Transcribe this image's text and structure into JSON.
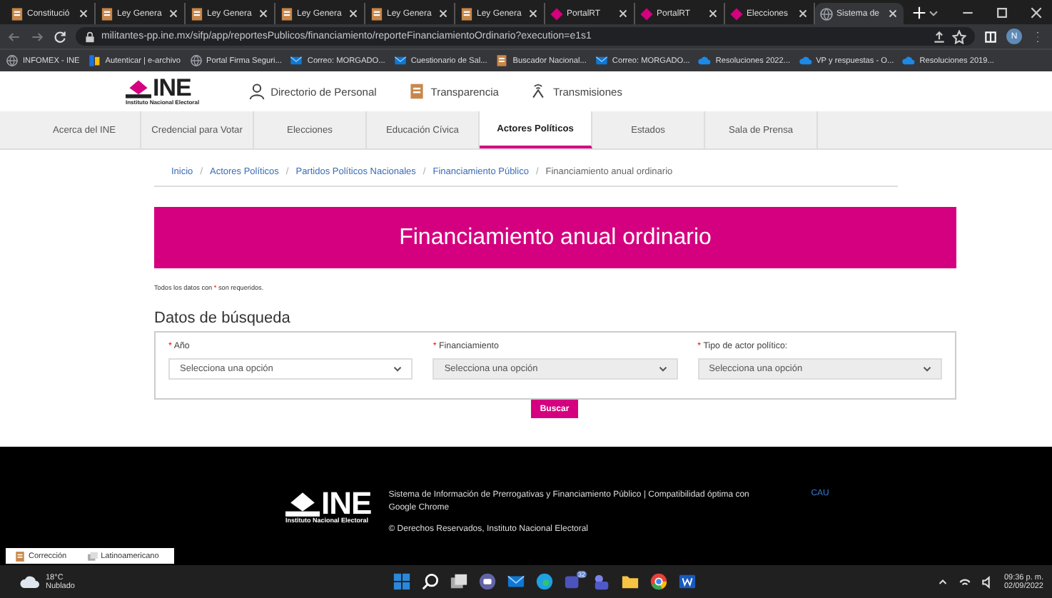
{
  "browser": {
    "tabs": [
      {
        "label": "Constitució",
        "kind": "doc",
        "selected": false
      },
      {
        "label": "Ley Genera",
        "kind": "doc",
        "selected": false
      },
      {
        "label": "Ley Genera",
        "kind": "doc",
        "selected": false
      },
      {
        "label": "Ley Genera",
        "kind": "doc",
        "selected": false
      },
      {
        "label": "Ley Genera",
        "kind": "doc",
        "selected": false
      },
      {
        "label": "Ley Genera",
        "kind": "doc",
        "selected": false
      },
      {
        "label": "PortalRT",
        "kind": "diamond",
        "selected": false
      },
      {
        "label": "PortalRT",
        "kind": "diamond",
        "selected": false
      },
      {
        "label": "Elecciones",
        "kind": "diamond",
        "selected": false
      },
      {
        "label": "Sistema de",
        "kind": "globe",
        "selected": true
      }
    ],
    "url": "militantes-pp.ine.mx/sifp/app/reportesPublicos/financiamiento/reporteFinanciamientoOrdinario?execution=e1s1",
    "profile": "N",
    "bookmarks": [
      {
        "label": "INFOMEX - INE",
        "kind": "globe"
      },
      {
        "label": "Autenticar | e-archivo",
        "kind": "flag"
      },
      {
        "label": "Portal Firma Seguri...",
        "kind": "globe"
      },
      {
        "label": "Correo: MORGADO...",
        "kind": "mail"
      },
      {
        "label": "Cuestionario de Sal...",
        "kind": "mail"
      },
      {
        "label": "Buscador Nacional...",
        "kind": "doc"
      },
      {
        "label": "Correo: MORGADO...",
        "kind": "mail"
      },
      {
        "label": "Resoluciones 2022...",
        "kind": "cloud"
      },
      {
        "label": "VP y respuestas - O...",
        "kind": "cloud"
      },
      {
        "label": "Resoluciones 2019...",
        "kind": "cloud"
      }
    ]
  },
  "header": {
    "logo": "INE",
    "logo_sub": "Instituto Nacional Electoral",
    "links": [
      {
        "label": "Directorio de Personal",
        "kind": "person"
      },
      {
        "label": "Transparencia",
        "kind": "doc"
      },
      {
        "label": "Transmisiones",
        "kind": "antenna"
      }
    ]
  },
  "nav": [
    {
      "label": "Acerca del INE",
      "selected": false
    },
    {
      "label": "Credencial para Votar",
      "selected": false
    },
    {
      "label": "Elecciones",
      "selected": false
    },
    {
      "label": "Educación Cívica",
      "selected": false
    },
    {
      "label": "Actores Políticos",
      "selected": true
    },
    {
      "label": "Estados",
      "selected": false
    },
    {
      "label": "Sala de Prensa",
      "selected": false
    }
  ],
  "breadcrumb": [
    {
      "label": "Inicio",
      "link": true
    },
    {
      "separator": "/",
      "label": "Actores Políticos",
      "link": true
    },
    {
      "separator": "/",
      "label": "Partidos Políticos Nacionales",
      "link": true
    },
    {
      "separator": "/",
      "label": "Financiamiento Público",
      "link": true
    },
    {
      "separator": "/",
      "label": "Financiamiento anual ordinario",
      "link": false
    }
  ],
  "banner": "Financiamiento anual ordinario",
  "required_note": {
    "before": "Todos los datos con",
    "mark": "*",
    "after": "son requeridos."
  },
  "form": {
    "title": "Datos de búsqueda",
    "fields": [
      {
        "label": "Año",
        "required": true,
        "placeholder": "Selecciona una opción",
        "disabled": false
      },
      {
        "label": "Financiamiento",
        "required": true,
        "placeholder": "Selecciona una opción",
        "disabled": true
      },
      {
        "label": "Tipo de actor político:",
        "required": true,
        "placeholder": "Selecciona una opción",
        "disabled": true
      }
    ],
    "button": "Buscar"
  },
  "footer": {
    "logo": "INE",
    "logo_sub": "Instituto Nacional Electoral",
    "text": "Sistema de Información de Prerrogativas y Financiamiento Público | Compatibilidad óptima con Google Chrome",
    "copyright": "© Derechos Reservados, Instituto Nacional Electoral",
    "link": "CAU"
  },
  "language_bar": [
    "Corrección",
    "Latinoamericano"
  ],
  "taskbar": {
    "weather_temp": "18°C",
    "weather_text": "Nublado",
    "apps": [
      {
        "kind": "windows"
      },
      {
        "kind": "search"
      },
      {
        "kind": "taskview"
      },
      {
        "kind": "chat"
      },
      {
        "kind": "mail"
      },
      {
        "kind": "edge"
      },
      {
        "kind": "teams",
        "badge": "32"
      },
      {
        "kind": "teams2"
      },
      {
        "kind": "folder"
      },
      {
        "kind": "chrome"
      },
      {
        "kind": "word"
      }
    ],
    "time": "09:36 p. m.",
    "date": "02/09/2022"
  }
}
